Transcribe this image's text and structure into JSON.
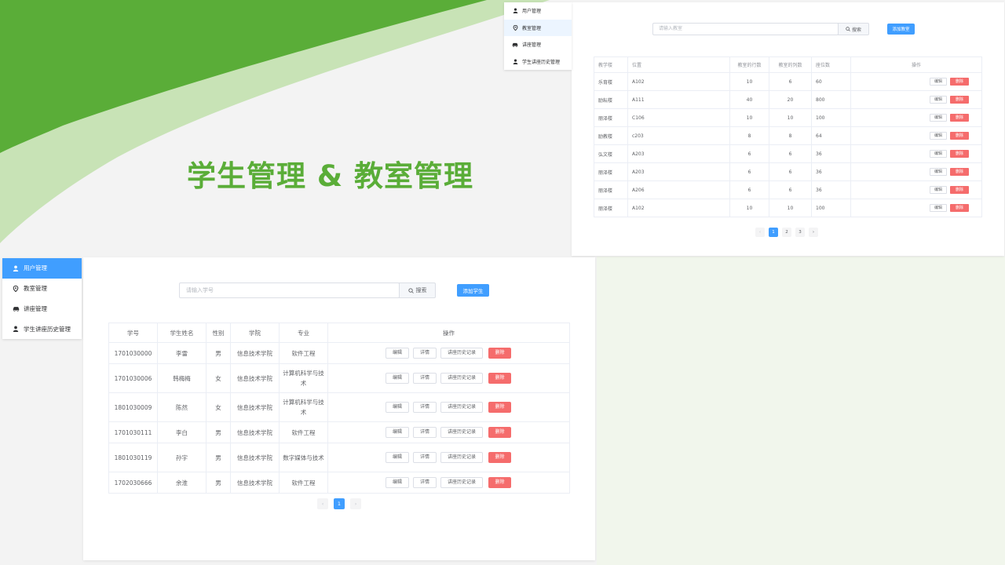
{
  "slide": {
    "title": "学生管理  &  教室管理"
  },
  "colors": {
    "brand_green": "#5aad38",
    "primary": "#409eff",
    "danger": "#f56c6c"
  },
  "menu": {
    "items": [
      {
        "label": "用户管理",
        "icon": "user-icon"
      },
      {
        "label": "教室管理",
        "icon": "location-icon"
      },
      {
        "label": "讲座管理",
        "icon": "car-icon"
      },
      {
        "label": "学生讲座历史管理",
        "icon": "user-icon"
      }
    ]
  },
  "classroom": {
    "active_menu": "教室管理",
    "search_placeholder": "请输入教室",
    "search_button": "搜索",
    "add_button": "添加教室",
    "columns": [
      "教学楼",
      "位置",
      "教室的行数",
      "教室的列数",
      "座位数",
      "操作"
    ],
    "rows": [
      [
        "乐育楼",
        "A102",
        "10",
        "6",
        "60"
      ],
      [
        "励耘楼",
        "A111",
        "40",
        "20",
        "800"
      ],
      [
        "丽泽楼",
        "C106",
        "10",
        "10",
        "100"
      ],
      [
        "励教楼",
        "c203",
        "8",
        "8",
        "64"
      ],
      [
        "弘文楼",
        "A203",
        "6",
        "6",
        "36"
      ],
      [
        "丽泽楼",
        "A203",
        "6",
        "6",
        "36"
      ],
      [
        "丽泽楼",
        "A206",
        "6",
        "6",
        "36"
      ],
      [
        "丽泽楼",
        "A102",
        "10",
        "10",
        "100"
      ]
    ],
    "actions": {
      "edit": "编辑",
      "delete": "删除"
    },
    "pagination": {
      "prev": "‹",
      "pages": [
        "1",
        "2",
        "3"
      ],
      "current": "1",
      "next": "›"
    }
  },
  "student": {
    "active_menu": "用户管理",
    "search_placeholder": "请输入学号",
    "search_button": "搜索",
    "add_button": "添加学生",
    "columns": [
      "学号",
      "学生姓名",
      "性别",
      "学院",
      "专业",
      "操作"
    ],
    "rows": [
      [
        "1701030000",
        "李雷",
        "男",
        "信息技术学院",
        "软件工程"
      ],
      [
        "1701030006",
        "韩梅梅",
        "女",
        "信息技术学院",
        "计算机科学与技术"
      ],
      [
        "1801030009",
        "陈然",
        "女",
        "信息技术学院",
        "计算机科学与技术"
      ],
      [
        "1701030111",
        "李白",
        "男",
        "信息技术学院",
        "软件工程"
      ],
      [
        "1801030119",
        "孙宇",
        "男",
        "信息技术学院",
        "数字媒体与技术"
      ],
      [
        "1702030666",
        "余淮",
        "男",
        "信息技术学院",
        "软件工程"
      ]
    ],
    "actions": {
      "edit": "编辑",
      "detail": "详情",
      "history": "讲座历史记录",
      "delete": "删除"
    },
    "pagination": {
      "prev": "‹",
      "pages": [
        "1"
      ],
      "current": "1",
      "next": "›"
    }
  }
}
